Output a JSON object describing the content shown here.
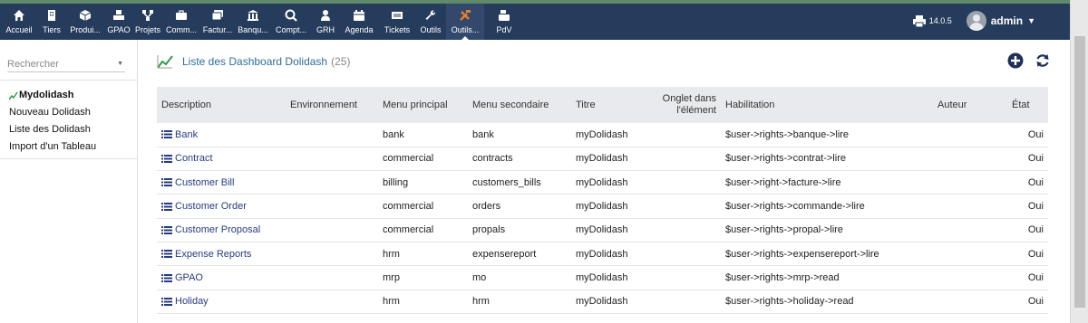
{
  "topbar": {
    "menu": [
      {
        "label": "Accueil",
        "icon": "home-icon"
      },
      {
        "label": "Tiers",
        "icon": "building-icon"
      },
      {
        "label": "Produi...",
        "icon": "cube-icon"
      },
      {
        "label": "GPAO",
        "icon": "cubes-icon"
      },
      {
        "label": "Projets",
        "icon": "sitemap-icon"
      },
      {
        "label": "Comm...",
        "icon": "suitcase-icon"
      },
      {
        "label": "Factur...",
        "icon": "money-bill-icon"
      },
      {
        "label": "Banqu...",
        "icon": "bank-icon"
      },
      {
        "label": "Compt...",
        "icon": "search-dollar-icon"
      },
      {
        "label": "GRH",
        "icon": "user-tie-icon"
      },
      {
        "label": "Agenda",
        "icon": "calendar-icon"
      },
      {
        "label": "Tickets",
        "icon": "ticket-icon"
      },
      {
        "label": "Outils",
        "icon": "wrench-icon"
      },
      {
        "label": "Outils...",
        "icon": "tools-icon",
        "active": true
      },
      {
        "label": "PdV",
        "icon": "cash-register-icon"
      }
    ],
    "version": "14.0.5",
    "username": "admin"
  },
  "sidebar": {
    "search_placeholder": "Rechercher",
    "title": "Mydolidash",
    "entries": [
      "Nouveau Dolidash",
      "Liste des Dolidash",
      "Import d'un Tableau"
    ]
  },
  "page": {
    "title": "Liste des Dashboard Dolidash",
    "count": "(25)"
  },
  "table": {
    "headers": [
      "Description",
      "Environnement",
      "Menu principal",
      "Menu secondaire",
      "Titre",
      "Onglet dans l'élément",
      "Habilitation",
      "Auteur",
      "État"
    ],
    "rows": [
      {
        "description": "Bank",
        "environnement": "",
        "menu_principal": "bank",
        "menu_secondaire": "bank",
        "titre": "myDolidash",
        "onglet": "",
        "habilitation": "$user->rights->banque->lire",
        "auteur": "",
        "etat": "Oui"
      },
      {
        "description": "Contract",
        "environnement": "",
        "menu_principal": "commercial",
        "menu_secondaire": "contracts",
        "titre": "myDolidash",
        "onglet": "",
        "habilitation": "$user->rights->contrat->lire",
        "auteur": "",
        "etat": "Oui"
      },
      {
        "description": "Customer Bill",
        "environnement": "",
        "menu_principal": "billing",
        "menu_secondaire": "customers_bills",
        "titre": "myDolidash",
        "onglet": "",
        "habilitation": "$user->right->facture->lire",
        "auteur": "",
        "etat": "Oui"
      },
      {
        "description": "Customer Order",
        "environnement": "",
        "menu_principal": "commercial",
        "menu_secondaire": "orders",
        "titre": "myDolidash",
        "onglet": "",
        "habilitation": "$user->rights->commande->lire",
        "auteur": "",
        "etat": "Oui"
      },
      {
        "description": "Customer Proposal",
        "environnement": "",
        "menu_principal": "commercial",
        "menu_secondaire": "propals",
        "titre": "myDolidash",
        "onglet": "",
        "habilitation": "$user->rights->propal->lire",
        "auteur": "",
        "etat": "Oui"
      },
      {
        "description": "Expense Reports",
        "environnement": "",
        "menu_principal": "hrm",
        "menu_secondaire": "expensereport",
        "titre": "myDolidash",
        "onglet": "",
        "habilitation": "$user->rights->expensereport->lire",
        "auteur": "",
        "etat": "Oui"
      },
      {
        "description": "GPAO",
        "environnement": "",
        "menu_principal": "mrp",
        "menu_secondaire": "mo",
        "titre": "myDolidash",
        "onglet": "",
        "habilitation": "$user->rights->mrp->read",
        "auteur": "",
        "etat": "Oui"
      },
      {
        "description": "Holiday",
        "environnement": "",
        "menu_principal": "hrm",
        "menu_secondaire": "hrm",
        "titre": "myDolidash",
        "onglet": "",
        "habilitation": "$user->rights->holiday->read",
        "auteur": "",
        "etat": "Oui"
      }
    ]
  }
}
